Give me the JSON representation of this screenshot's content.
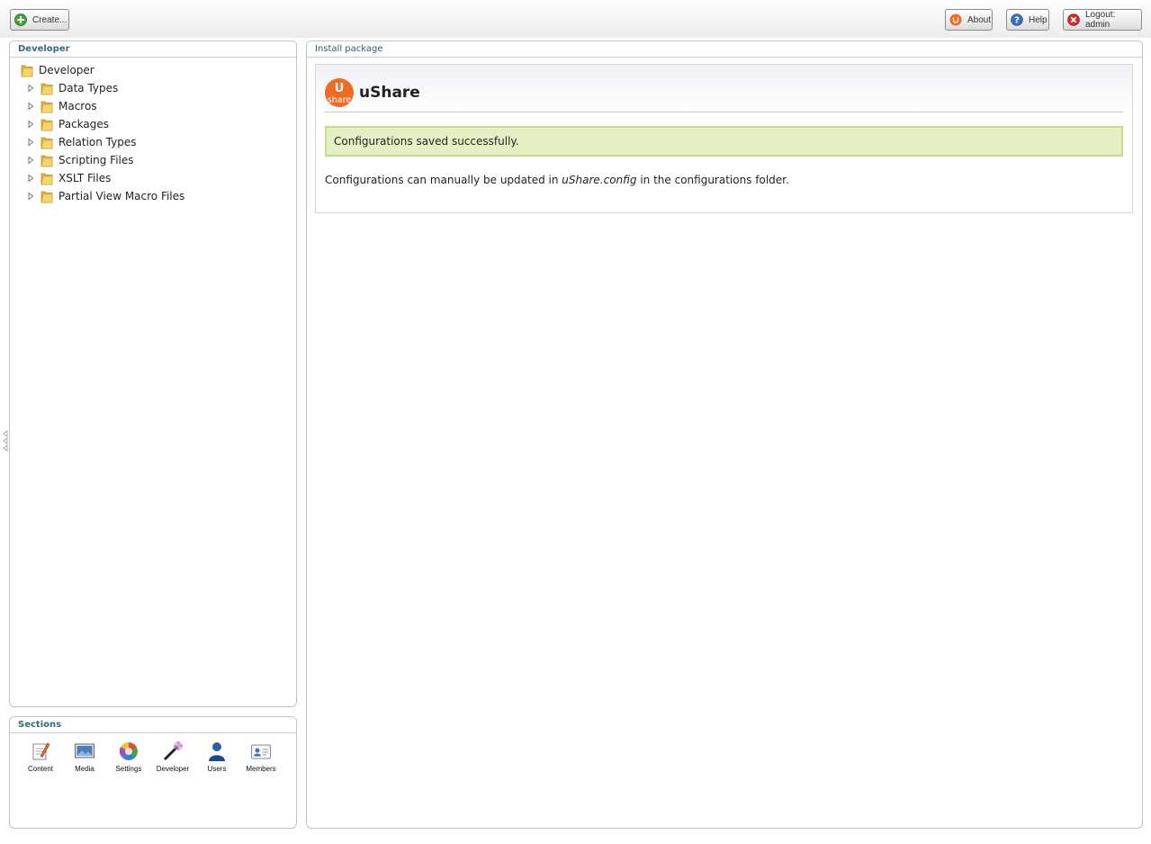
{
  "topbar": {
    "create_label": "Create...",
    "about_label": "About",
    "help_label": "Help",
    "logout_label": "Logout: admin"
  },
  "tree_panel": {
    "title": "Developer",
    "root": "Developer",
    "items": [
      {
        "label": "Data Types"
      },
      {
        "label": "Macros"
      },
      {
        "label": "Packages"
      },
      {
        "label": "Relation Types"
      },
      {
        "label": "Scripting Files"
      },
      {
        "label": "XSLT Files"
      },
      {
        "label": "Partial View Macro Files"
      }
    ]
  },
  "sections_panel": {
    "title": "Sections",
    "items": [
      {
        "label": "Content",
        "icon": "content-icon"
      },
      {
        "label": "Media",
        "icon": "media-icon"
      },
      {
        "label": "Settings",
        "icon": "settings-icon"
      },
      {
        "label": "Developer",
        "icon": "developer-icon"
      },
      {
        "label": "Users",
        "icon": "users-icon"
      },
      {
        "label": "Members",
        "icon": "members-icon"
      }
    ]
  },
  "main_panel": {
    "title": "Install package",
    "package": {
      "logo_top": "U",
      "logo_bottom": "share",
      "name": "uShare"
    },
    "success_message": "Configurations saved successfully.",
    "note_before": "Configurations can manually be updated in ",
    "note_file": "uShare.config",
    "note_after": " in the configurations folder."
  },
  "colors": {
    "panel_header_text": "#39697c",
    "success_bg": "#e4f0c3",
    "success_border": "#c4dc85",
    "logo_orange": "#ef6a23"
  }
}
